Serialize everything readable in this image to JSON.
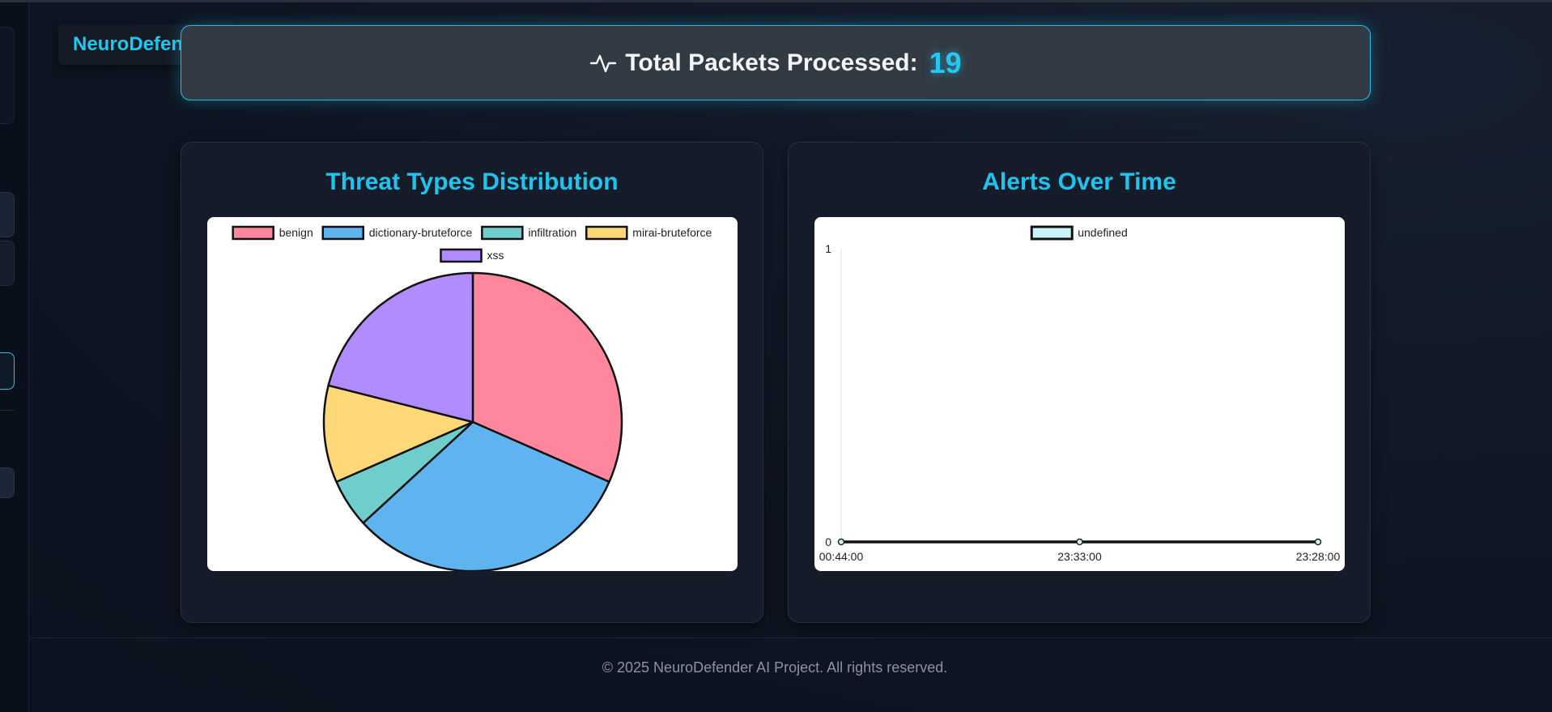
{
  "brand": {
    "name": "NeuroDefender"
  },
  "stats": {
    "label": "Total Packets Processed:",
    "value": "19",
    "icon": "activity-pulse-icon"
  },
  "threat_card": {
    "title": "Threat Types Distribution"
  },
  "alerts_card": {
    "title": "Alerts Over Time"
  },
  "footer": {
    "text": "© 2025 NeuroDefender AI Project. All rights reserved."
  },
  "colors": {
    "accent": "#1fc4ee",
    "background": "#0c1320",
    "card": "#141c2a"
  },
  "chart_data": [
    {
      "type": "pie",
      "categories": [
        "benign",
        "dictionary-bruteforce",
        "infiltration",
        "mirai-bruteforce",
        "xss"
      ],
      "values": [
        6,
        6,
        1,
        2,
        4
      ],
      "colors": [
        "#ff879d",
        "#5fb4f0",
        "#6fcdcb",
        "#ffd977",
        "#b08cff"
      ],
      "legend": "top"
    },
    {
      "type": "line",
      "x": [
        "00:44:00",
        "23:33:00",
        "23:28:00"
      ],
      "series": [
        {
          "name": "undefined",
          "values": [
            0,
            0,
            0
          ],
          "color": "#111111",
          "fill": "#ccf3fb"
        }
      ],
      "ylim": [
        0,
        1
      ],
      "yticks": [
        "0",
        "1"
      ],
      "legend": "top"
    }
  ]
}
